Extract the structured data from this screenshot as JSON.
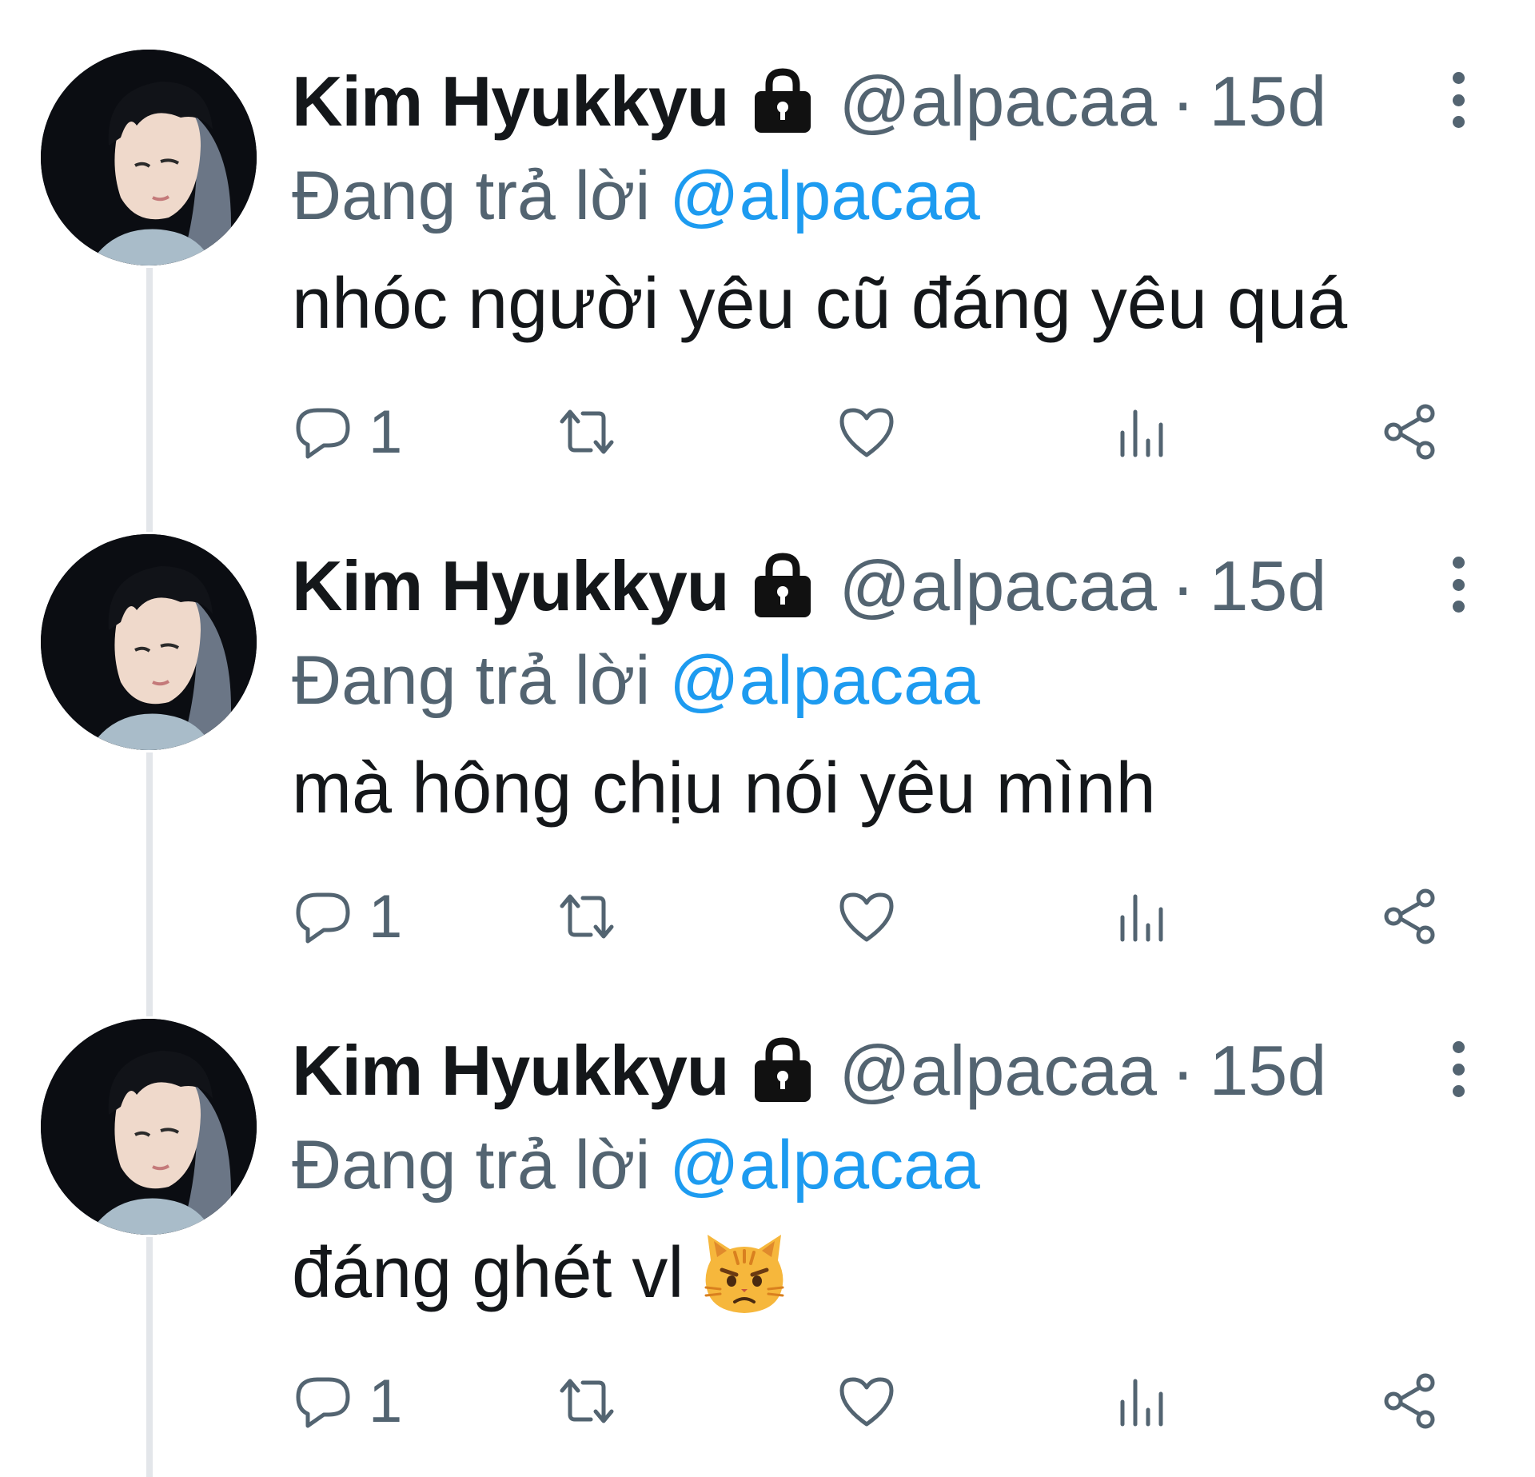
{
  "tweets": [
    {
      "author_name": "Kim Hyukkyu",
      "handle": "@alpacaa",
      "separator": "·",
      "time": "15d",
      "replying_prefix": "Đang trả lời",
      "replying_to": "@alpacaa",
      "text": "nhóc người yêu cũ đáng yêu quá",
      "reply_count": "1"
    },
    {
      "author_name": "Kim Hyukkyu",
      "handle": "@alpacaa",
      "separator": "·",
      "time": "15d",
      "replying_prefix": "Đang trả lời",
      "replying_to": "@alpacaa",
      "text": "mà hông chịu nói yêu mình",
      "reply_count": "1"
    },
    {
      "author_name": "Kim Hyukkyu",
      "handle": "@alpacaa",
      "separator": "·",
      "time": "15d",
      "replying_prefix": "Đang trả lời",
      "replying_to": "@alpacaa",
      "text": "đáng ghét vl",
      "emoji": "pouting-cat-emoji",
      "reply_count": "1"
    }
  ],
  "icons": {
    "verified": "lock-icon",
    "more": "more-options-icon",
    "reply": "reply-icon",
    "retweet": "retweet-icon",
    "like": "heart-icon",
    "views": "views-icon",
    "share": "share-icon"
  },
  "colors": {
    "text": "#14171a",
    "secondary": "#536471",
    "accent": "#1d9bf0",
    "thread_line": "#e3e6ea"
  }
}
